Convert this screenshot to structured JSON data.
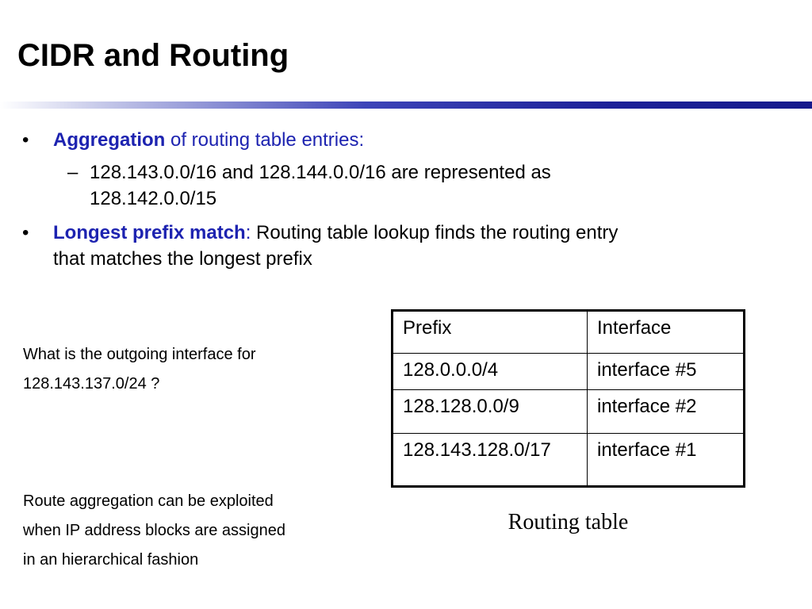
{
  "slide": {
    "title": "CIDR and Routing"
  },
  "bullets": [
    {
      "marker": "•",
      "emphasis": "Aggregation",
      "text": " of routing table entries:",
      "sub": {
        "marker": "–",
        "line1": "128.143.0.0/16 and 128.144.0.0/16 are represented as",
        "line2": "128.142.0.0/15"
      }
    },
    {
      "marker": "•",
      "emphasis": "Longest prefix match",
      "colon": ":",
      "text": " Routing table lookup finds the routing entry",
      "text2": "that matches the longest prefix"
    }
  ],
  "question": {
    "line1": "What is the outgoing interface for",
    "line2": "128.143.137.0/24 ?"
  },
  "note": {
    "line1": "Route aggregation can be exploited",
    "line2": "when IP address blocks are assigned",
    "line3": "in an hierarchical fashion"
  },
  "routing_table": {
    "headers": [
      "Prefix",
      "Interface"
    ],
    "rows": [
      [
        "128.0.0.0/4",
        "interface #5"
      ],
      [
        "128.128.0.0/9",
        "interface #2"
      ],
      [
        "128.143.128.0/17",
        "interface #1"
      ]
    ],
    "caption": "Routing table"
  },
  "colors": {
    "accent": "#1d23b0",
    "rule_dark": "#161a8c"
  }
}
